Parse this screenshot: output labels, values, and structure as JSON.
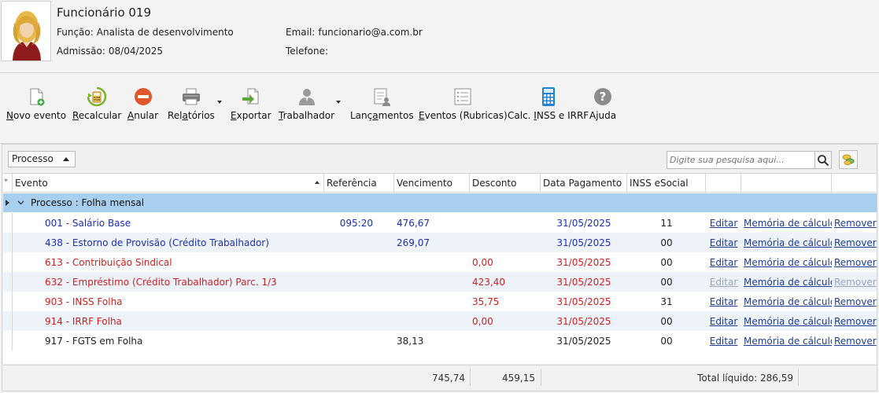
{
  "employee": {
    "name": "Funcionário 019",
    "funcao_label": "Função:",
    "funcao": "Analista de desenvolvimento",
    "admissao_label": "Admissão:",
    "admissao": "08/04/2025",
    "email_label": "Email:",
    "email": "funcionario@a.com.br",
    "telefone_label": "Telefone:",
    "telefone": ""
  },
  "toolbar": [
    {
      "name": "novo-evento",
      "pre": "",
      "hot": "N",
      "post": "ovo evento",
      "icon": "new-document-icon"
    },
    {
      "name": "recalcular",
      "pre": "",
      "hot": "R",
      "post": "ecalcular",
      "icon": "calculator-refresh-icon"
    },
    {
      "name": "anular",
      "pre": "",
      "hot": "A",
      "post": "nular",
      "icon": "cancel-icon"
    },
    {
      "name": "relatorios",
      "pre": "Rel",
      "hot": "a",
      "post": "tórios",
      "icon": "printer-icon"
    },
    {
      "name": "exportar",
      "pre": "",
      "hot": "E",
      "post": "xportar",
      "icon": "export-icon"
    },
    {
      "name": "trabalhador",
      "pre": "",
      "hot": "T",
      "post": "rabalhador",
      "icon": "user-icon"
    },
    {
      "name": "lancamentos",
      "pre": "Lanç",
      "hot": "a",
      "post": "mentos",
      "icon": "entries-icon"
    },
    {
      "name": "eventos-rubricas",
      "pre": "",
      "hot": "E",
      "post": "ventos (Rubricas)",
      "icon": "list-icon"
    },
    {
      "name": "calc-inss-irrf",
      "pre": "Calc. ",
      "hot": "I",
      "post": "NSS e IRRF",
      "icon": "calculator-icon"
    },
    {
      "name": "ajuda",
      "pre": "Ajuda",
      "hot": "",
      "post": "",
      "icon": "help-icon"
    }
  ],
  "group_select": {
    "value": "Processo"
  },
  "search": {
    "placeholder": "Digite sua pesquisa aqui..."
  },
  "columns": [
    "Evento",
    "Referência",
    "Vencimento",
    "Desconto",
    "Data Pagamento",
    "INSS eSocial"
  ],
  "group": {
    "label": "Processo : Folha mensal"
  },
  "links": {
    "edit": "Editar",
    "memory": "Memória de cálculo",
    "remove": "Remover"
  },
  "rows": [
    {
      "evento": "001 - Salário Base",
      "referencia": "095:20",
      "vencimento": "476,67",
      "desconto": "",
      "data": "31/05/2025",
      "inss": "11",
      "color": "#1b2fb5",
      "actions_disabled": false
    },
    {
      "evento": "438 - Estorno de Provisão (Crédito Trabalhador)",
      "referencia": "",
      "vencimento": "269,07",
      "desconto": "",
      "data": "31/05/2025",
      "inss": "00",
      "color": "#1b2fb5",
      "actions_disabled": false
    },
    {
      "evento": "613 - Contribuição Sindical",
      "referencia": "",
      "vencimento": "",
      "desconto": "0,00",
      "data": "31/05/2025",
      "inss": "00",
      "color": "#d01f1f",
      "actions_disabled": false
    },
    {
      "evento": "632 - Empréstimo (Crédito Trabalhador) Parc. 1/3",
      "referencia": "",
      "vencimento": "",
      "desconto": "423,40",
      "data": "31/05/2025",
      "inss": "00",
      "color": "#d01f1f",
      "actions_disabled": true
    },
    {
      "evento": "903 - INSS Folha",
      "referencia": "",
      "vencimento": "",
      "desconto": "35,75",
      "data": "31/05/2025",
      "inss": "31",
      "color": "#d01f1f",
      "actions_disabled": false
    },
    {
      "evento": "914 - IRRF Folha",
      "referencia": "",
      "vencimento": "",
      "desconto": "0,00",
      "data": "31/05/2025",
      "inss": "00",
      "color": "#d01f1f",
      "actions_disabled": false
    },
    {
      "evento": "917 - FGTS em Folha",
      "referencia": "",
      "vencimento": "38,13",
      "desconto": "",
      "data": "31/05/2025",
      "inss": "00",
      "color": "#222222",
      "actions_disabled": false
    }
  ],
  "footer": {
    "total_vencimento": "745,74",
    "total_desconto": "459,15",
    "total_liquido": "Total líquido: 286,59"
  }
}
